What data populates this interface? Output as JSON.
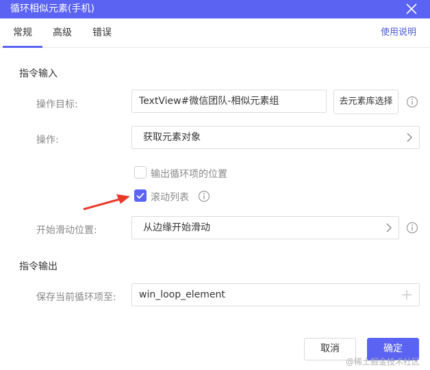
{
  "window": {
    "title": "循环相似元素(手机)"
  },
  "tabs": [
    {
      "label": "常规",
      "active": true
    },
    {
      "label": "高级",
      "active": false
    },
    {
      "label": "错误",
      "active": false
    }
  ],
  "help_link": "使用说明",
  "instruction_input": {
    "section_title": "指令输入",
    "target": {
      "label": "操作目标:",
      "value": "TextView#微信团队-相似元素组",
      "library_button": "去元素库选择"
    },
    "operation": {
      "label": "操作:",
      "value": "获取元素对象"
    },
    "output_position_checkbox": {
      "label": "输出循环项的位置",
      "checked": false
    },
    "scroll_list_checkbox": {
      "label": "滚动列表",
      "checked": true
    },
    "start_scroll": {
      "label": "开始滑动位置:",
      "value": "从边缘开始滑动"
    }
  },
  "instruction_output": {
    "section_title": "指令输出",
    "save_to": {
      "label": "保存当前循环项至:",
      "value": "win_loop_element"
    }
  },
  "footer": {
    "cancel_label": "取消",
    "ok_label": "确定",
    "watermark": "@稀土掘金技术社区"
  },
  "colors": {
    "accent": "#5b63f2",
    "arrow": "#e8392b"
  }
}
